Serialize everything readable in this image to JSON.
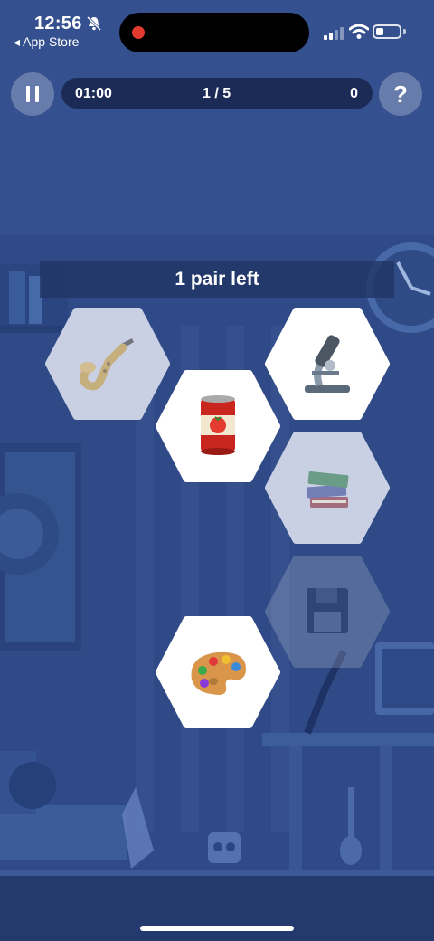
{
  "status_bar": {
    "time": "12:56",
    "back_app": "◂ App Store",
    "battery_level": 0.35
  },
  "game": {
    "timer": "01:00",
    "progress": "1 / 5",
    "score": "0",
    "help_label": "?",
    "pairs_left": "1 pair left"
  },
  "tiles": [
    {
      "name": "saxophone",
      "state": "dimmed"
    },
    {
      "name": "tomato-can",
      "state": "active"
    },
    {
      "name": "microscope",
      "state": "active"
    },
    {
      "name": "books",
      "state": "dimmed"
    },
    {
      "name": "floppy-disk",
      "state": "matched"
    },
    {
      "name": "paint-palette",
      "state": "active"
    }
  ],
  "colors": {
    "background": "#34508f",
    "bar": "#1c2b55",
    "tile_active": "#ffffff",
    "tile_dimmed": "#c9d0e4",
    "record_dot": "#e53a2f"
  }
}
